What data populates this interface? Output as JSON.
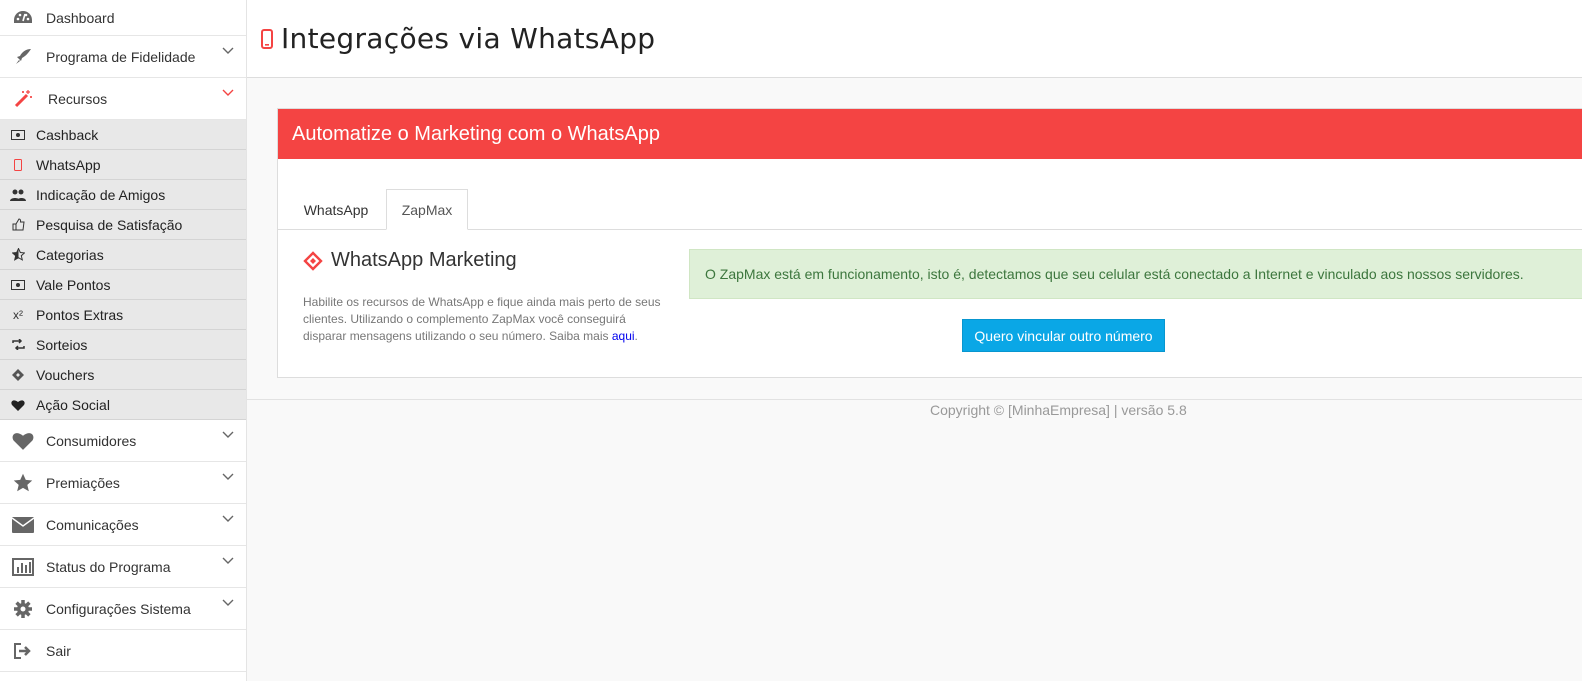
{
  "sidebar": {
    "items_top": [
      {
        "label": "Dashboard",
        "icon": "dashboard-icon",
        "chevron": false
      },
      {
        "label": "Programa de Fidelidade",
        "icon": "rocket-icon",
        "chevron": true
      },
      {
        "label": "Recursos",
        "icon": "magic-wand-icon",
        "chevron": true,
        "active": true
      }
    ],
    "subitems": [
      {
        "label": "Cashback",
        "icon": "money-icon"
      },
      {
        "label": "WhatsApp",
        "icon": "mobile-icon"
      },
      {
        "label": "Indicação de Amigos",
        "icon": "users-icon"
      },
      {
        "label": "Pesquisa de Satisfação",
        "icon": "thumbs-up-icon"
      },
      {
        "label": "Categorias",
        "icon": "star-half-icon"
      },
      {
        "label": "Vale Pontos",
        "icon": "money-icon"
      },
      {
        "label": "Pontos Extras",
        "icon": "superscript-icon",
        "glyph": "x²"
      },
      {
        "label": "Sorteios",
        "icon": "retweet-icon"
      },
      {
        "label": "Vouchers",
        "icon": "ticket-icon"
      },
      {
        "label": "Ação Social",
        "icon": "heart-icon"
      }
    ],
    "items_bottom": [
      {
        "label": "Consumidores",
        "icon": "heart-icon",
        "chevron": true
      },
      {
        "label": "Premiações",
        "icon": "star-icon",
        "chevron": true
      },
      {
        "label": "Comunicações",
        "icon": "envelope-icon",
        "chevron": true
      },
      {
        "label": "Status do Programa",
        "icon": "bar-chart-icon",
        "chevron": true
      },
      {
        "label": "Configurações Sistema",
        "icon": "gear-icon",
        "chevron": true
      },
      {
        "label": "Sair",
        "icon": "sign-out-icon",
        "chevron": false
      }
    ]
  },
  "header": {
    "title": "Integrações via WhatsApp",
    "icon": "mobile-icon"
  },
  "panel": {
    "heading": "Automatize o Marketing com o WhatsApp",
    "tabs": [
      {
        "label": "WhatsApp",
        "active": false
      },
      {
        "label": "ZapMax",
        "active": true
      }
    ],
    "section_title": "WhatsApp Marketing",
    "description": "Habilite os recursos de WhatsApp e fique ainda mais perto de seus clientes. Utilizando o complemento ZapMax você conseguirá disparar mensagens utilizando o seu número. Saiba mais",
    "link_text": "aqui",
    "link_suffix": ".",
    "alert": "O ZapMax está em funcionamento, isto é, detectamos que seu celular está conectado a Internet e vinculado aos nossos servidores.",
    "button": "Quero vincular outro número"
  },
  "footer": {
    "copyright": "Copyright © [MinhaEmpresa] | versão 5.8"
  },
  "colors": {
    "accent_red": "#f44443",
    "alert_bg": "#dff0d8",
    "alert_text": "#3c763d",
    "button_blue": "#0aa7e6"
  }
}
